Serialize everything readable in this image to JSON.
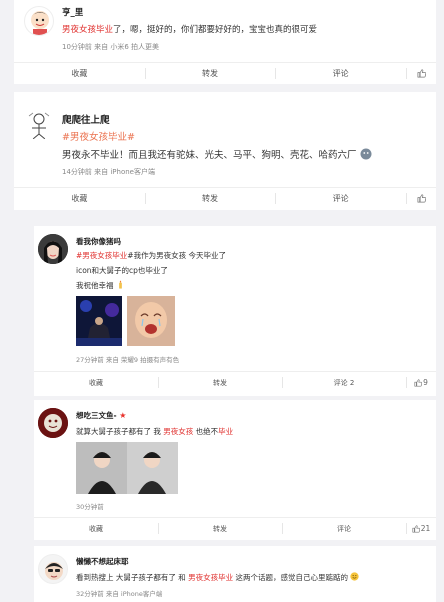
{
  "posts": [
    {
      "username": "亨_里",
      "text_tag": "男夜女孩毕业",
      "text_rest": "了，嗯，挺好的，你们都要好好的，宝宝也真的很可爱",
      "meta": "10分钟前 来自 小米6 拍人更美",
      "actions": [
        "收藏",
        "转发",
        "评论"
      ]
    },
    {
      "username": "爬爬往上爬",
      "topic": "#男夜女孩毕业#",
      "body": "男夜永不毕业！而且我还有驼妹、光夫、马平、狗明、壳花、哈药六厂",
      "meta": "14分钟前 来自 iPhone客户端",
      "actions": [
        "收藏",
        "转发",
        "评论"
      ]
    },
    {
      "username": "看我你像猪吗",
      "line1_topic": "#男夜女孩毕业",
      "line1_rest": "#我作为男夜女孩 今天毕业了",
      "line2": "icon和大舅子的cp也毕业了",
      "line3": "我祝他幸福",
      "meta": "27分钟前 来自 荣耀9 拍摄有声有色",
      "actions": [
        "收藏",
        "转发",
        "评论 2"
      ],
      "likes": "9"
    },
    {
      "username": "想吃三文鱼-",
      "line_a": "就算大舅子孩子都有了 我 ",
      "line_tag": "男夜女孩",
      "line_b": " 也绝不",
      "line_tag2": "毕业",
      "meta": "30分钟前",
      "actions": [
        "收藏",
        "转发",
        "评论"
      ],
      "likes": "21"
    },
    {
      "username": "懒懒不想起床耶",
      "line_a": "看到热搜上 大舅子孩子都有了 和 ",
      "line_tag": "男夜女孩毕业",
      "line_b": " 这两个话题，感觉自己心里踮踮的",
      "meta": "32分钟前 来自 iPhone客户端"
    }
  ],
  "colors": {
    "highlight": "#e0302e",
    "topic": "#eb7350",
    "star": "#e8302a"
  }
}
